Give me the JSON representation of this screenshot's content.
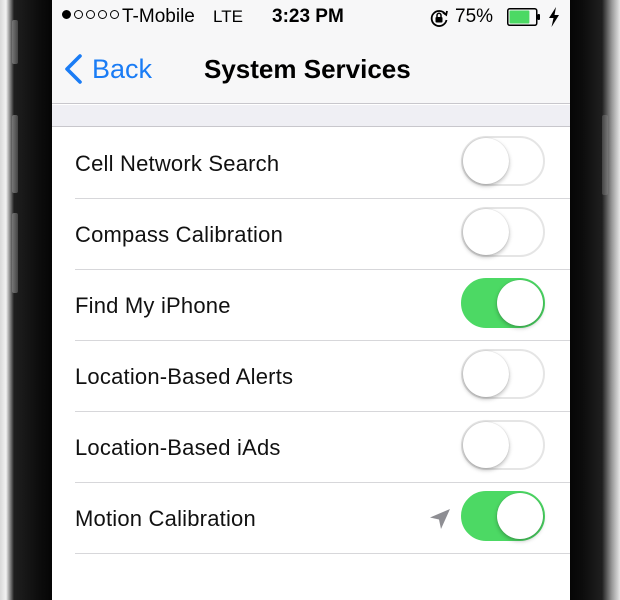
{
  "status_bar": {
    "signal_dots": [
      true,
      false,
      false,
      false,
      false
    ],
    "carrier": "T-Mobile",
    "network": "LTE",
    "time": "3:23 PM",
    "battery_percent": "75%",
    "battery_level": 0.75,
    "icons": [
      "rotation-lock-icon",
      "battery-icon",
      "charging-bolt-icon"
    ]
  },
  "nav": {
    "back_label": "Back",
    "title": "System Services"
  },
  "services": [
    {
      "label": "Cell Network Search",
      "on": false,
      "location_arrow": false
    },
    {
      "label": "Compass Calibration",
      "on": false,
      "location_arrow": false
    },
    {
      "label": "Find My iPhone",
      "on": true,
      "location_arrow": false
    },
    {
      "label": "Location-Based Alerts",
      "on": false,
      "location_arrow": false
    },
    {
      "label": "Location-Based iAds",
      "on": false,
      "location_arrow": false
    },
    {
      "label": "Motion Calibration",
      "on": true,
      "location_arrow": true
    }
  ],
  "colors": {
    "accent": "#1a7cf5",
    "toggle_on": "#4cd964",
    "battery_fill": "#4cd964",
    "location_arrow": "#8e8e93"
  }
}
